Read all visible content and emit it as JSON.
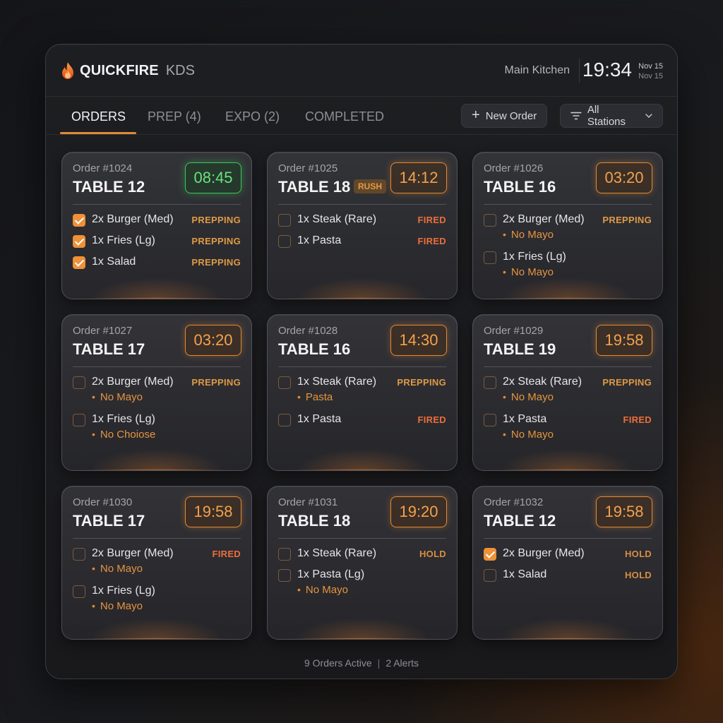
{
  "header": {
    "brand_primary": "QUICKFIRE",
    "brand_secondary": "KDS",
    "location": "Main Kitchen",
    "time": "19:34",
    "date_line1": "Nov 15",
    "date_line2": "Nov 15"
  },
  "tabs": [
    {
      "label": "ORDERS",
      "active": true
    },
    {
      "label": "PREP (4)",
      "active": false
    },
    {
      "label": "EXPO (2)",
      "active": false
    },
    {
      "label": "COMPLETED",
      "active": false
    }
  ],
  "toolbar": {
    "new_order_label": "New Order",
    "filter_label": "All Stations"
  },
  "orders": [
    {
      "order_no": "Order #1024",
      "table": "TABLE 12",
      "timer": "08:45",
      "timer_color": "green",
      "items": [
        {
          "name": "2x Burger (Med)",
          "status": "PREPPING",
          "checked": true
        },
        {
          "name": "1x Fries (Lg)",
          "status": "PREPPING",
          "checked": true
        },
        {
          "name": "1x Salad",
          "status": "PREPPING",
          "checked": true
        }
      ]
    },
    {
      "order_no": "Order #1025",
      "table": "TABLE 18",
      "badge": "RUSH",
      "timer": "14:12",
      "timer_color": "orange",
      "items": [
        {
          "name": "1x Steak (Rare)",
          "status": "FIRED",
          "checked": false
        },
        {
          "name": "1x Pasta",
          "status": "FIRED",
          "checked": false
        }
      ]
    },
    {
      "order_no": "Order #1026",
      "table": "TABLE 16",
      "timer": "03:20",
      "timer_color": "orange",
      "items": [
        {
          "name": "2x Burger (Med)",
          "status": "PREPPING",
          "checked": false,
          "modifier": "No Mayo"
        },
        {
          "name": "1x Fries (Lg)",
          "status": "",
          "checked": false,
          "modifier": "No Mayo"
        }
      ]
    },
    {
      "order_no": "Order #1027",
      "table": "TABLE 17",
      "timer": "03:20",
      "timer_color": "orange",
      "items": [
        {
          "name": "2x Burger (Med)",
          "status": "PREPPING",
          "checked": false,
          "modifier": "No Mayo"
        },
        {
          "name": "1x Fries (Lg)",
          "status": "",
          "checked": false,
          "modifier": "No Choiose"
        }
      ]
    },
    {
      "order_no": "Order #1028",
      "table": "TABLE 16",
      "timer": "14:30",
      "timer_color": "orange",
      "items": [
        {
          "name": "1x Steak (Rare)",
          "status": "PREPPING",
          "checked": false,
          "modifier": "Pasta"
        },
        {
          "name": "1x Pasta",
          "status": "FIRED",
          "checked": false
        }
      ]
    },
    {
      "order_no": "Order #1029",
      "table": "TABLE 19",
      "timer": "19:58",
      "timer_color": "orange",
      "items": [
        {
          "name": "2x Steak (Rare)",
          "status": "PREPPING",
          "checked": false,
          "modifier": "No Mayo"
        },
        {
          "name": "1x Pasta",
          "status": "FIRED",
          "checked": false,
          "modifier": "No Mayo"
        }
      ]
    },
    {
      "order_no": "Order #1030",
      "table": "TABLE 17",
      "timer": "19:58",
      "timer_color": "orange",
      "items": [
        {
          "name": "2x Burger (Med)",
          "status": "FIRED",
          "checked": false,
          "modifier": "No Mayo"
        },
        {
          "name": "1x Fries (Lg)",
          "status": "",
          "checked": false,
          "modifier": "No Mayo"
        }
      ]
    },
    {
      "order_no": "Order #1031",
      "table": "TABLE 18",
      "timer": "19:20",
      "timer_color": "orange",
      "items": [
        {
          "name": "1x Steak (Rare)",
          "status": "HOLD",
          "checked": false
        },
        {
          "name": "1x Pasta (Lg)",
          "status": "",
          "checked": false,
          "modifier": "No Mayo"
        }
      ]
    },
    {
      "order_no": "Order #1032",
      "table": "TABLE 12",
      "timer": "19:58",
      "timer_color": "orange",
      "items": [
        {
          "name": "2x Burger (Med)",
          "status": "HOLD",
          "checked": true
        },
        {
          "name": "1x Salad",
          "status": "HOLD",
          "checked": false
        }
      ]
    }
  ],
  "footer": {
    "active_orders": "9 Orders Active",
    "alerts": "2 Alerts"
  },
  "colors": {
    "accent": "#e08a3a",
    "timer_green": "#3ec85a",
    "status_fired": "#ec6e3a",
    "status_prepping": "#e09a45"
  }
}
